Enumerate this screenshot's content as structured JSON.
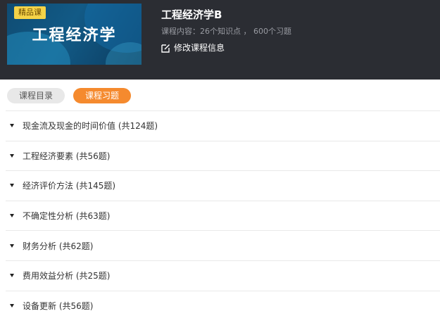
{
  "course": {
    "badge": "精品课",
    "cover_title": "工程经济学",
    "title": "工程经济学B",
    "meta": "课程内容：26个知识点 ， 600个习题",
    "edit_label": "修改课程信息"
  },
  "tabs": [
    {
      "label": "课程目录",
      "active": false
    },
    {
      "label": "课程习题",
      "active": true
    }
  ],
  "chapters": [
    {
      "label": "现金流及现金的时间价值 (共124题)"
    },
    {
      "label": "工程经济要素 (共56题)"
    },
    {
      "label": "经济评价方法 (共145题)"
    },
    {
      "label": "不确定性分析 (共63题)"
    },
    {
      "label": "财务分析 (共62题)"
    },
    {
      "label": "费用效益分析 (共25题)"
    },
    {
      "label": "设备更新 (共56题)"
    }
  ],
  "colors": {
    "header_bg": "#2b2d33",
    "accent": "#f58a2e",
    "badge": "#f5d348"
  },
  "icons": {
    "edit": "edit-icon",
    "caret": "caret-down-icon"
  }
}
